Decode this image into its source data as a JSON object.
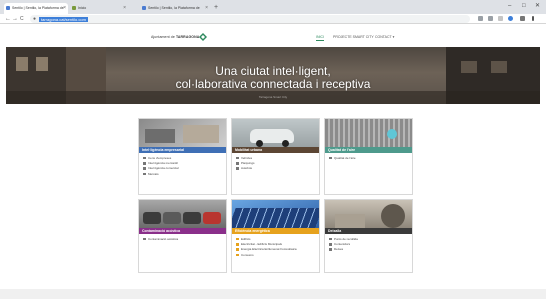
{
  "browser": {
    "tabs": [
      {
        "label": "Sentilo | Sentilo, la Plataforma de",
        "active": true
      },
      {
        "label": "Inicio",
        "active": false
      },
      {
        "label": "Sentilo | Sentilo, la Plataforma de",
        "active": false
      }
    ],
    "new_tab": "+",
    "url": "tarragona.cat/sentilo.com",
    "controls": {
      "minimize": "–",
      "maximize": "□",
      "close": "✕"
    },
    "nav": {
      "back": "←",
      "forward": "→",
      "reload": "C"
    }
  },
  "site": {
    "logo": {
      "prefix": "Ajuntament de",
      "name": "TARRAGONA"
    },
    "nav": [
      {
        "label": "INICI",
        "active": true
      },
      {
        "label": "PROJECTE SMART CITY",
        "active": false
      },
      {
        "label": "CONTACT ▾",
        "active": false
      }
    ]
  },
  "hero": {
    "line1": "Una ciutat intel·ligent,",
    "line2": "col·laborativa connectada i receptiva",
    "subtitle": "Tarragona Smart City"
  },
  "cards": [
    {
      "title": "Intel·ligència empresarial",
      "color": "#3f6fb5",
      "items": [
        "Cens d'empreses",
        "Intel·ligència mercantil",
        "Intel·ligència comercial",
        "Mercats"
      ]
    },
    {
      "title": "Mobilitat urbana",
      "color": "#5c4634",
      "items": [
        "Vehicles",
        "Pàrquings",
        "Autobús"
      ]
    },
    {
      "title": "Qualitat de l'aire",
      "color": "#4e9a8c",
      "items": [
        "Qualitat de l'aire"
      ]
    },
    {
      "title": "Contaminació acústica",
      "color": "#8a2f8a",
      "items": [
        "Contaminació acústica"
      ]
    },
    {
      "title": "Eficiència energètica",
      "color": "#e6a21d",
      "items": [
        "Edificis",
        "Electricitat - Edificis Municipals",
        "Energia Elèctrica Enllumenat Fotovoltaica",
        "Consums"
      ]
    },
    {
      "title": "Deixalla",
      "color": "#3a3a3a",
      "items": [
        "Punts de recollida",
        "Contenidors",
        "Deixes"
      ]
    }
  ]
}
